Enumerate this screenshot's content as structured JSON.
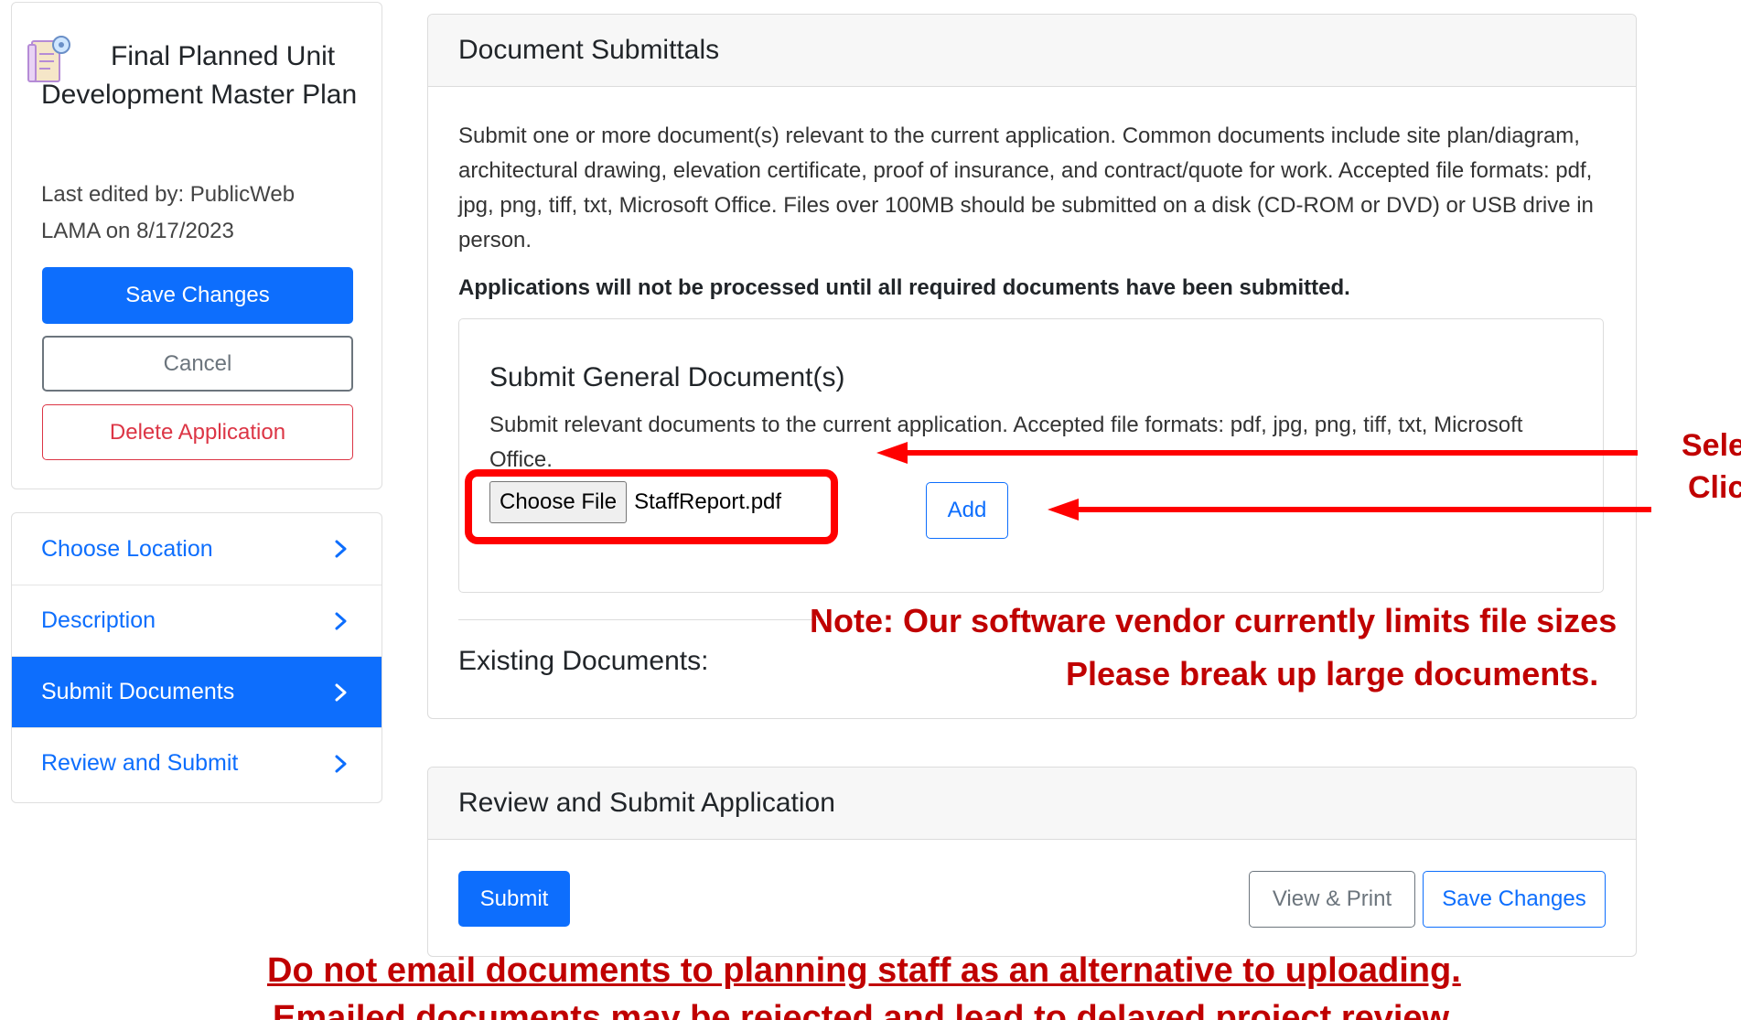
{
  "app": {
    "title": "Final Planned Unit Development Master Plan",
    "icon": "document-settings-icon",
    "last_edited": "Last edited by: PublicWeb LAMA on 8/17/2023",
    "save_label": "Save Changes",
    "cancel_label": "Cancel",
    "delete_label": "Delete Application"
  },
  "nav": {
    "items": [
      {
        "label": "Choose Location",
        "active": false
      },
      {
        "label": "Description",
        "active": false
      },
      {
        "label": "Submit Documents",
        "active": true
      },
      {
        "label": "Review and Submit",
        "active": false
      }
    ]
  },
  "documents": {
    "header": "Document Submittals",
    "description": "Submit one or more document(s) relevant to the current application. Common documents include site plan/diagram, architectural drawing, elevation certificate, proof of insurance, and contract/quote for work. Accepted file formats: pdf, jpg, png, tiff, txt, Microsoft Office. Files over 100MB should be submitted on a disk (CD-ROM or DVD) or USB drive in person.",
    "warning": "Applications will not be processed until all required documents have been submitted.",
    "general": {
      "title": "Submit General Document(s)",
      "description": "Submit relevant documents to the current application. Accepted file formats: pdf, jpg, png, tiff, txt, Microsoft Office.",
      "choose_file_label": "Choose File",
      "file_name": "StaffReport.pdf",
      "add_label": "Add"
    },
    "existing_label": "Existing Documents:"
  },
  "review": {
    "header": "Review and Submit Application",
    "submit_label": "Submit",
    "view_print_label": "View & Print",
    "save_label": "Save Changes"
  },
  "annotations": {
    "select_text": "Sele",
    "click_text": "Clic",
    "note_line1": "Note: Our software vendor currently limits file sizes",
    "note_line2": "Please break up large documents.",
    "email_line1": "Do not email documents to planning staff as an alternative to uploading.",
    "email_line2": "Emailed documents may be rejected and lead to delayed project review.",
    "color": "#c00000"
  },
  "colors": {
    "primary": "#0d6efd",
    "danger": "#dc3545",
    "secondary": "#6c757d",
    "highlight": "#ff0000"
  }
}
